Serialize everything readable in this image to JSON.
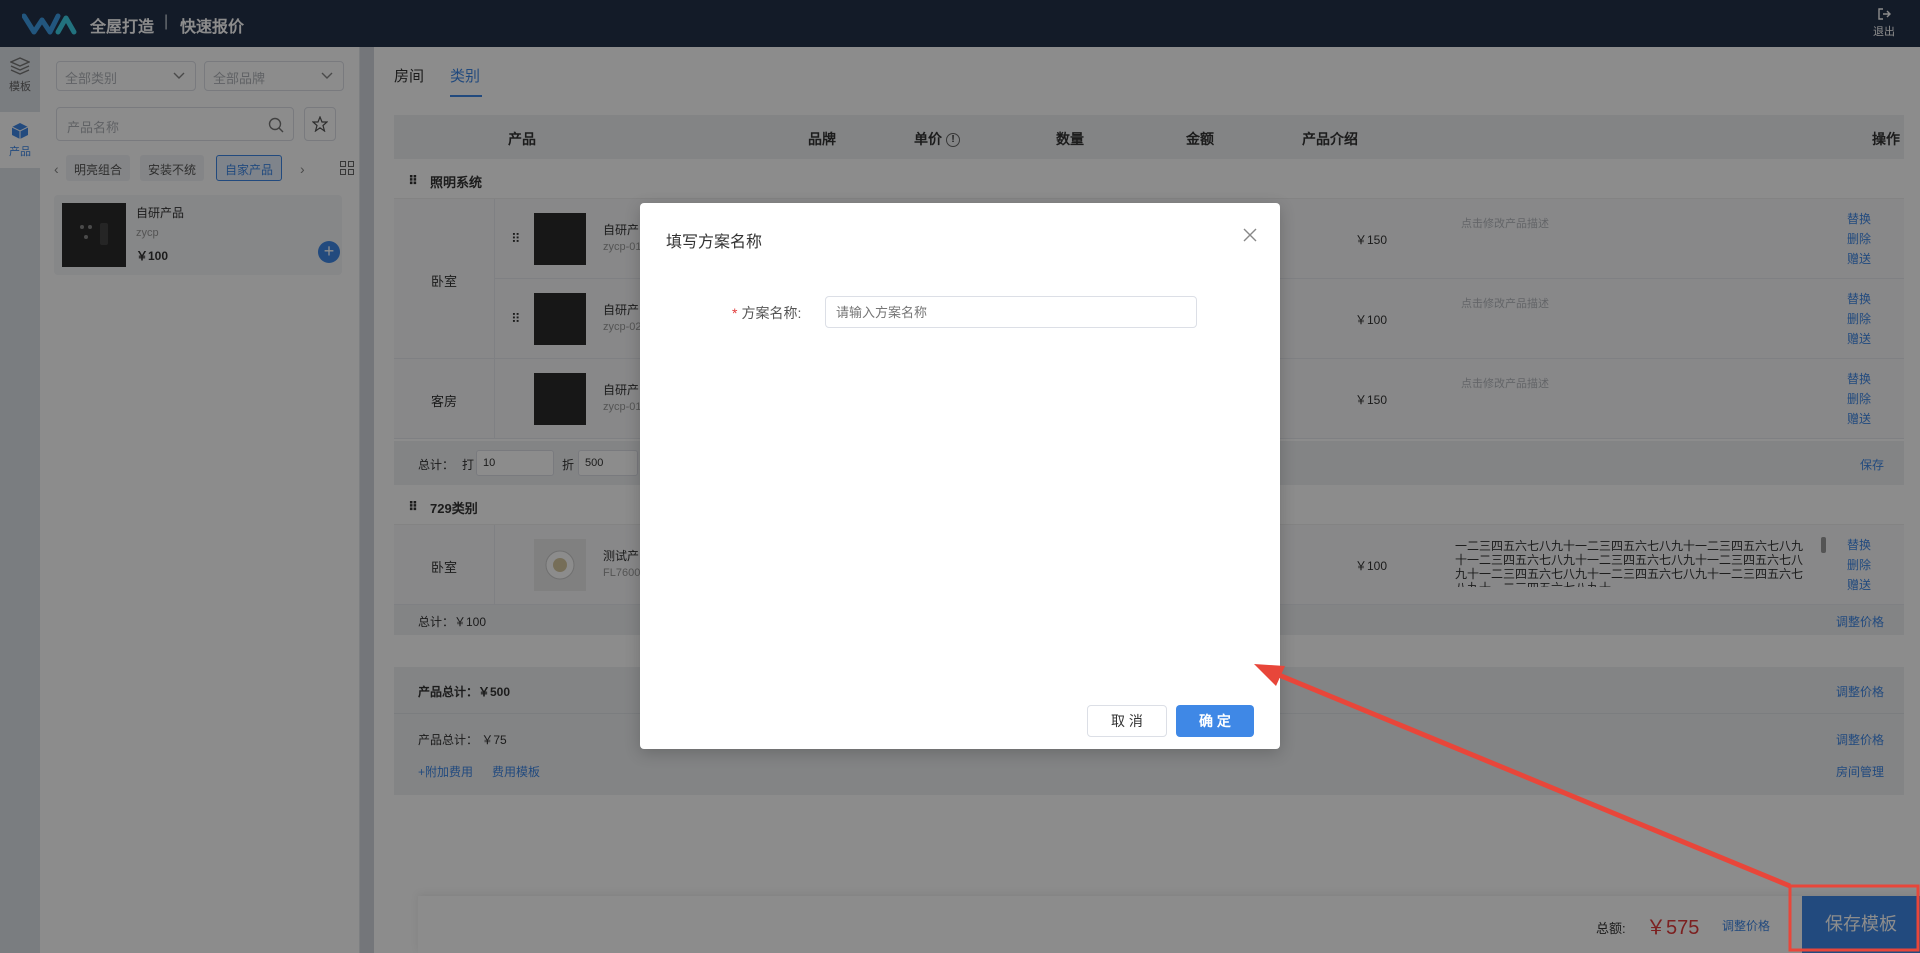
{
  "header": {
    "app_name": "全屋打造",
    "separator": "|",
    "page_title": "快速报价",
    "logout_label": "退出"
  },
  "rail": {
    "items": [
      {
        "label": "模板",
        "icon": "layers-icon"
      },
      {
        "label": "产品",
        "icon": "box-icon"
      }
    ]
  },
  "panel": {
    "category_select": "全部类别",
    "brand_select": "全部品牌",
    "search_placeholder": "产品名称",
    "chips": [
      "明亮组合",
      "安装不统",
      "自家产品"
    ],
    "active_chip": "自家产品",
    "card": {
      "name": "自研产品",
      "code": "zycp",
      "price": "￥100",
      "add": "+"
    }
  },
  "main": {
    "tabs": [
      "房间",
      "类别"
    ],
    "active_tab": "类别",
    "columns": [
      "产品",
      "品牌",
      "单价",
      "数量",
      "金额",
      "产品介绍",
      "操作"
    ],
    "groups": [
      {
        "title": "照明系统",
        "rooms": [
          "卧室",
          "客房"
        ],
        "items": [
          {
            "name": "自研产品",
            "code": "zycp-01",
            "amount": "￥150",
            "desc": "点击修改产品描述"
          },
          {
            "name": "自研产品",
            "code": "zycp-02",
            "amount": "￥100",
            "desc": "点击修改产品描述"
          },
          {
            "name": "自研产品",
            "code": "zycp-01",
            "amount": "￥150",
            "desc": "点击修改产品描述"
          }
        ],
        "summary": {
          "label": "总计：",
          "discount_label": "打",
          "discount": "10",
          "fold_label": "折",
          "total_input": "500",
          "action": "保存"
        }
      },
      {
        "title": "729类别",
        "rooms": [
          "卧室"
        ],
        "items": [
          {
            "name": "测试产品",
            "code": "FL7600",
            "amount": "￥100",
            "desc": "一二三四五六七八九十一二三四五六七八九十一二三四五六七八九十一二三四五六七八九十一二三四五六七八九十一二三四五六七八九十一二三四五六七八九十一二三四五六七八九十一二三四五六七八九十一二三四五六七八九十"
          }
        ],
        "summary": {
          "label": "总计：￥100",
          "action": "调整价格"
        }
      }
    ],
    "ops": [
      "替换",
      "删除",
      "赠送"
    ],
    "totals": {
      "product_total": "产品总计：￥500",
      "product_total_2": "产品总计：  ￥75",
      "extra_fee": "+附加费用",
      "fee_template": "费用模板",
      "adjust1": "调整价格",
      "adjust2": "调整价格",
      "room_manage": "房间管理"
    }
  },
  "footer": {
    "total_label": "总额:",
    "total_value": "￥575",
    "adjust_label": "调整价格",
    "save_template": "保存模板"
  },
  "modal": {
    "title": "填写方案名称",
    "field_label": "方案名称:",
    "required_mark": "*",
    "placeholder": "请输入方案名称",
    "cancel": "取 消",
    "ok": "确 定"
  },
  "colors": {
    "header_bg": "#24324a",
    "accent": "#3f88e6",
    "price_red": "#e23b3b",
    "annotation_red": "#e8463a"
  }
}
